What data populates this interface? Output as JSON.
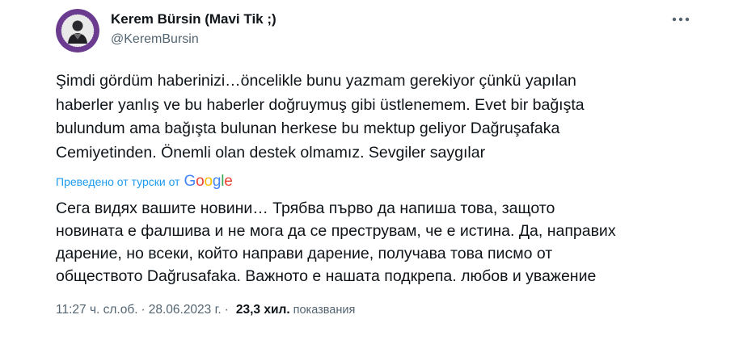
{
  "author": {
    "display_name": "Kerem Bürsin (Mavi Tik ;)",
    "handle": "@KeremBursin"
  },
  "tweet": {
    "text": "Şimdi gördüm haberinizi…öncelikle bunu yazmam gerekiyor çünkü yapılan\nhaberler yanlış ve bu haberler doğruymuş gibi üstlenemem. Evet bir bağışta\nbulundum ama bağışta bulunan herkese bu mektup geliyor Dağruşafaka\nCemiyetinden. Önemli olan destek olmamız. Sevgiler saygılar",
    "translated_by_label": "Преведено от турски от",
    "translation_provider": "Google",
    "translation": "Сега видях вашите новини… Трябва първо да напиша това, защото\nновината е фалшива и не мога да се преструвам, че е истина. Да, направих\nдарение, но всеки, който направи дарение, получава това писмо от\nобществото Dağrusafaka. Важното е нашата подкрепа. любов и уважение",
    "time": "11:27 ч. сл.об.",
    "date": "28.06.2023 г.",
    "separator": "·",
    "views_count": "23,3 хил.",
    "views_label": "показвания"
  },
  "icons": {
    "more": "more-horizontal-icon",
    "avatar": "profile-photo"
  },
  "colors": {
    "text_primary": "#0f1419",
    "text_secondary": "#536471",
    "link_blue": "#1d9bf0",
    "avatar_ring": "#6a3b8f"
  }
}
